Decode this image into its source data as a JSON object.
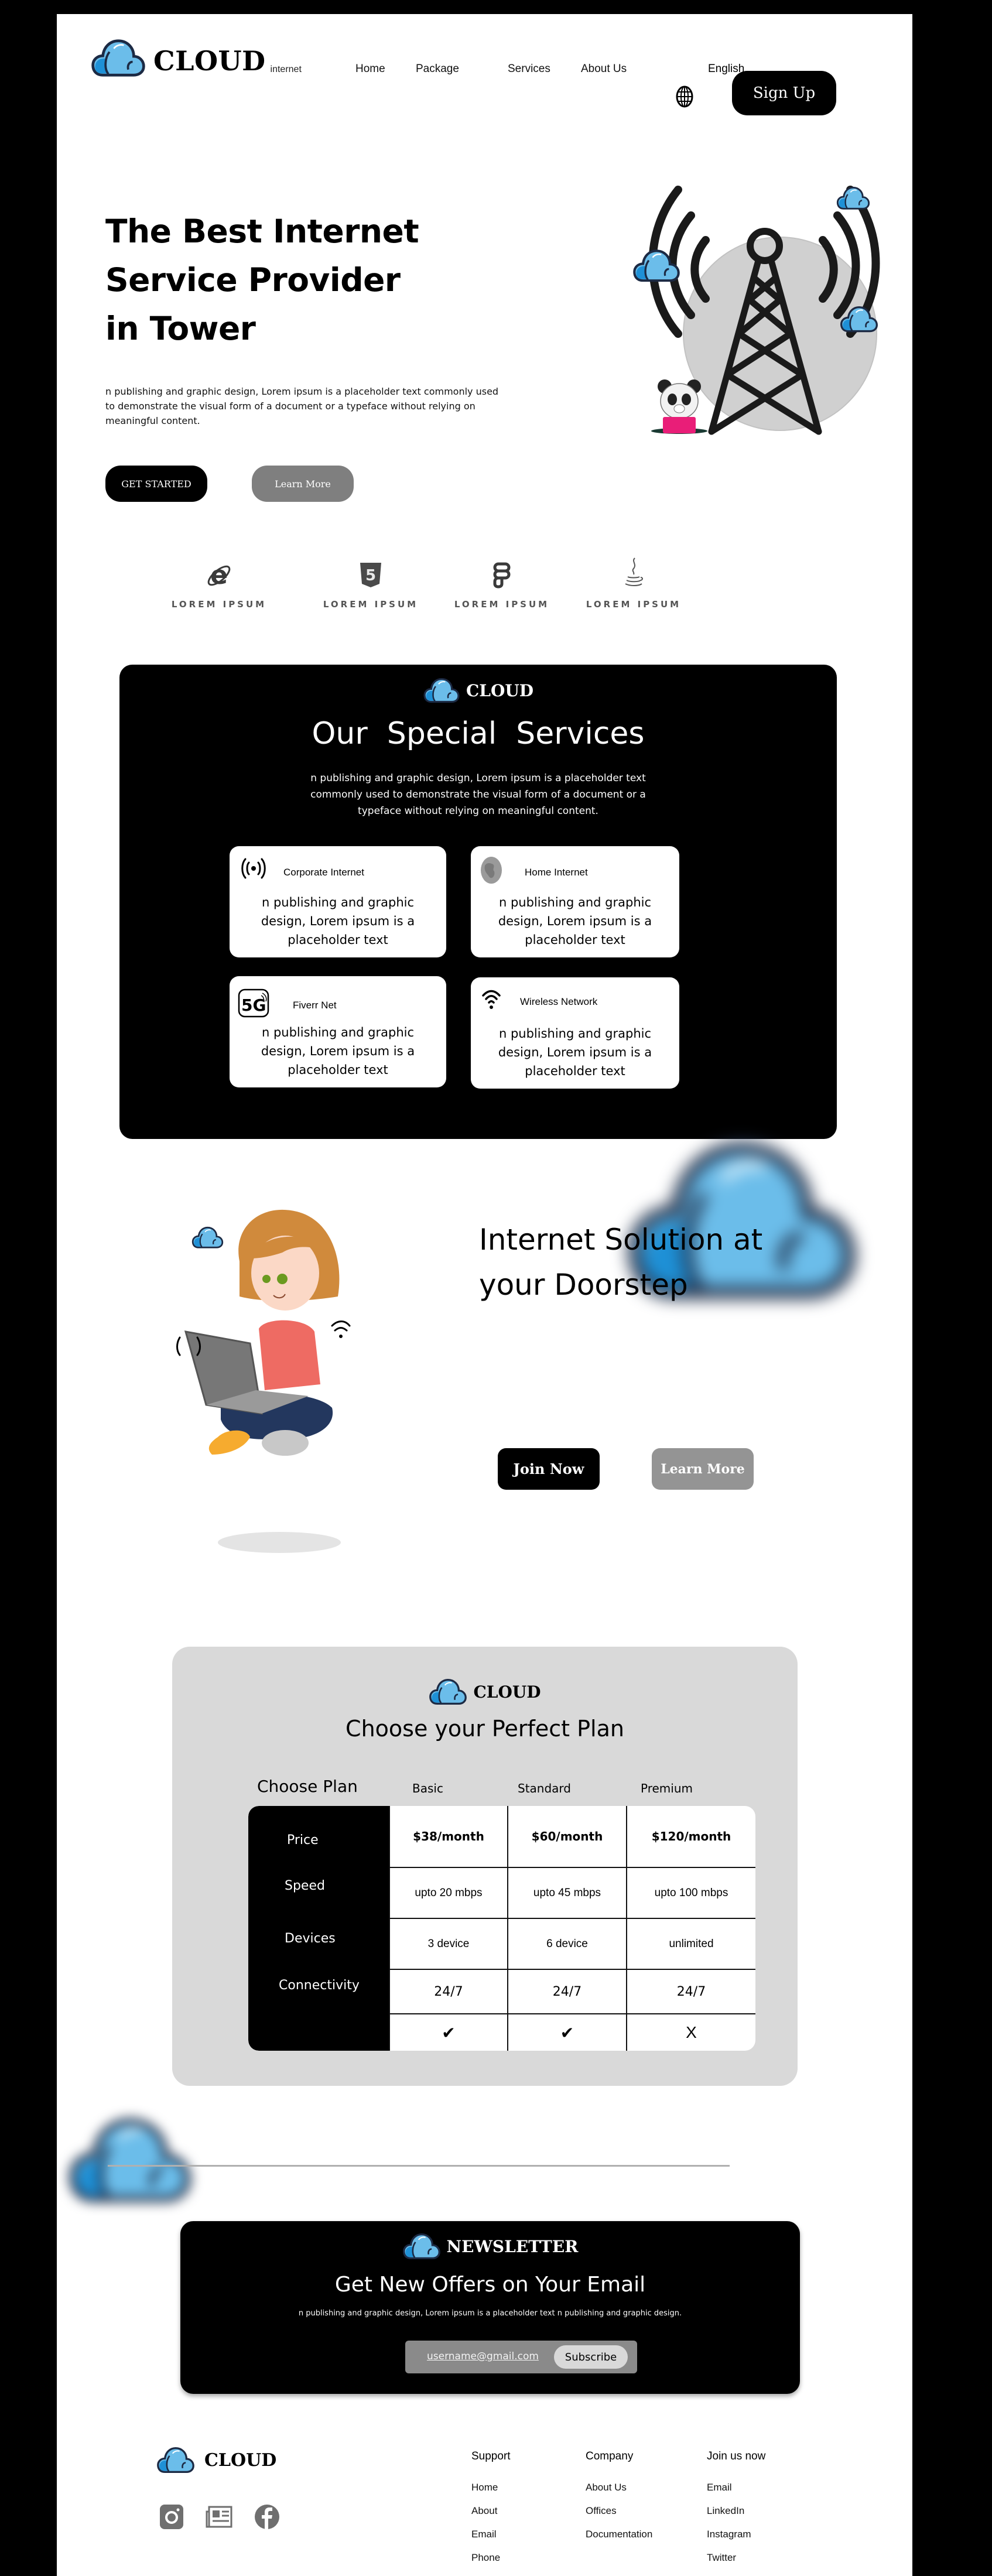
{
  "header": {
    "brand": "CLOUD",
    "brand_sub": "internet",
    "nav": [
      "Home",
      "Package",
      "Services",
      "About Us"
    ],
    "language": "English",
    "signup_label": "Sign Up"
  },
  "hero": {
    "title_lines": [
      "The Best Internet",
      "Service Provider",
      "in Tower"
    ],
    "description": "n publishing and graphic design, Lorem ipsum is a placeholder text commonly used to demonstrate the visual form of a document or a typeface without relying on meaningful content.",
    "primary_cta": "GET STARTED",
    "secondary_cta": "Learn More"
  },
  "partners": [
    {
      "icon": "internet-explorer-icon",
      "label": "LOREM IPSUM"
    },
    {
      "icon": "html5-icon",
      "label": "LOREM IPSUM"
    },
    {
      "icon": "figma-icon",
      "label": "LOREM IPSUM"
    },
    {
      "icon": "java-icon",
      "label": "LOREM IPSUM"
    }
  ],
  "services": {
    "brand": "CLOUD",
    "title": "Our  Special  Services",
    "description": "n publishing and graphic design, Lorem ipsum is a placeholder text commonly used to demonstrate the visual form of a document or a typeface without relying on meaningful content.",
    "cards": [
      {
        "icon": "broadcast-signal-icon",
        "title": "Corporate Internet",
        "text": "n publishing and graphic design, Lorem ipsum is a placeholder text"
      },
      {
        "icon": "globe-icon",
        "title": "Home Internet",
        "text": "n publishing and graphic design, Lorem ipsum is a placeholder text"
      },
      {
        "icon": "5g-icon",
        "title": "Fiverr Net",
        "text": "n publishing and graphic design, Lorem ipsum is a placeholder text"
      },
      {
        "icon": "wifi-icon",
        "title": "Wireless Network",
        "text": "n publishing and graphic design, Lorem ipsum is a placeholder text"
      }
    ]
  },
  "doorstep": {
    "title_lines": [
      "Internet Solution at",
      "your Doorstep"
    ],
    "join_label": "Join Now",
    "learn_label": "Learn More"
  },
  "plans": {
    "brand": "CLOUD",
    "title": "Choose your Perfect Plan",
    "corner_label": "Choose Plan",
    "columns": [
      "Basic",
      "Standard",
      "Premium"
    ],
    "rows": [
      {
        "label": "Price",
        "values": [
          "$38/month",
          "$60/month",
          "$120/month"
        ]
      },
      {
        "label": "Speed",
        "values": [
          "upto 20 mbps",
          "upto 45 mbps",
          "upto 100 mbps"
        ]
      },
      {
        "label": "Devices",
        "values": [
          "3 device",
          "6 device",
          "unlimited"
        ]
      },
      {
        "label": "Connectivity",
        "values": [
          "24/7",
          "24/7",
          "24/7"
        ]
      },
      {
        "label": "",
        "values": [
          "✔",
          "✔",
          "X"
        ]
      }
    ]
  },
  "newsletter": {
    "brand": "NEWSLETTER",
    "title": "Get New Offers on Your Email",
    "description": "n publishing and graphic design, Lorem ipsum is a placeholder text n publishing and graphic design.",
    "email_value": "username@gmail.com",
    "subscribe_label": "Subscribe"
  },
  "footer": {
    "brand": "CLOUD",
    "social": [
      "instagram-icon",
      "news-icon",
      "facebook-icon"
    ],
    "columns": [
      {
        "title": "Support",
        "links": [
          "Home",
          "About",
          "Email",
          "Phone"
        ]
      },
      {
        "title": "Company",
        "links": [
          "About Us",
          "Offices",
          "Documentation"
        ]
      },
      {
        "title": "Join us now",
        "links": [
          "Email",
          "LinkedIn",
          "Instagram",
          "Twitter"
        ]
      }
    ]
  },
  "colors": {
    "cloud_light": "#6bbdea",
    "cloud_dark": "#1e90d6",
    "cloud_outline": "#1c2a44",
    "panel_gray": "#d9d9d9",
    "button_gray": "#7f7f7f"
  }
}
